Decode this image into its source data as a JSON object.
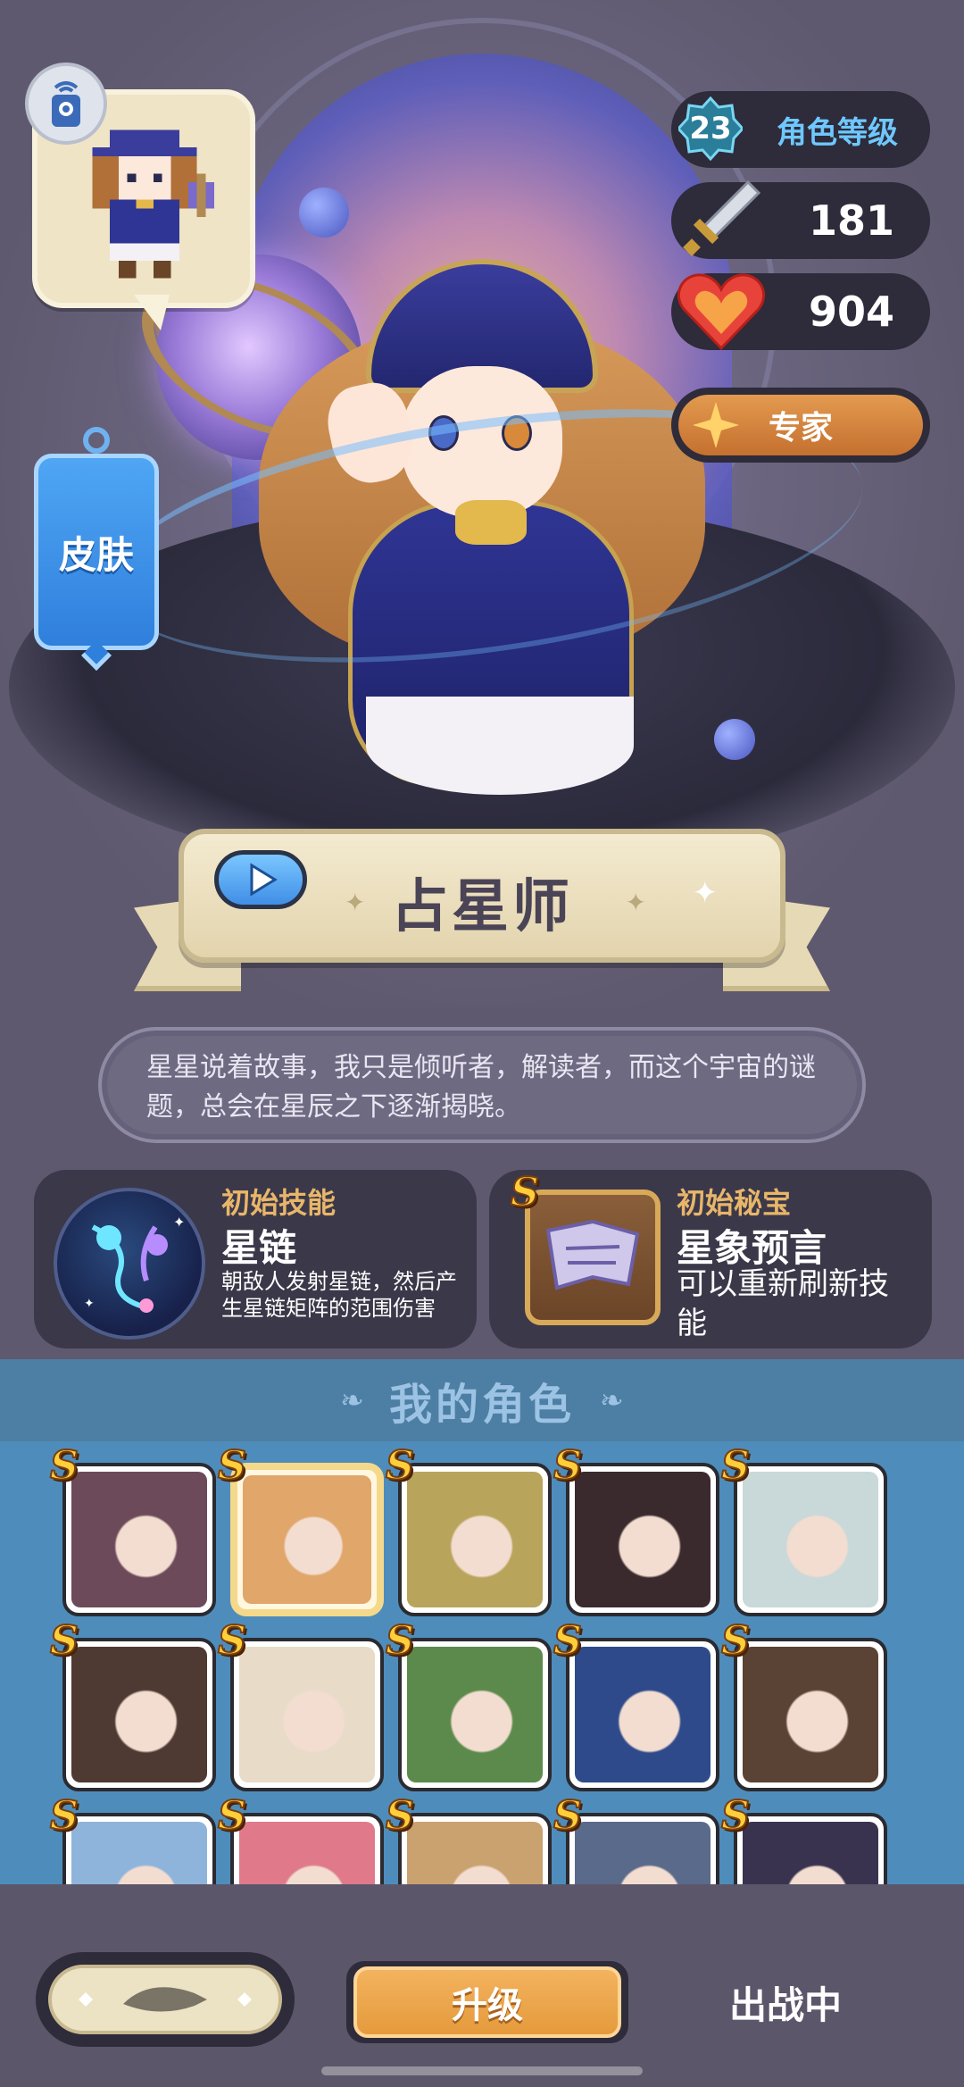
{
  "hero": {
    "name": "占星师",
    "quote": "星星说着故事，我只是倾听者，解读者，而这个宇宙的谜题，总会在星辰之下逐渐揭晓。"
  },
  "skin_button": {
    "label": "皮肤"
  },
  "stats": {
    "level": "23",
    "level_label": "角色等级",
    "attack": "181",
    "hp": "904",
    "rank_label": "专家"
  },
  "skill": {
    "title": "初始技能",
    "name": "星链",
    "desc": "朝敌人发射星链，然后产生星链矩阵的范围伤害"
  },
  "treasure": {
    "badge": "S",
    "title": "初始秘宝",
    "name": "星象预言",
    "desc": "可以重新刷新技能"
  },
  "roster": {
    "title": "我的角色",
    "tiles": [
      {
        "badge": "S",
        "color": "#6c4a5a"
      },
      {
        "badge": "S",
        "color": "#e0a66a",
        "selected": true
      },
      {
        "badge": "S",
        "color": "#b9a45c"
      },
      {
        "badge": "S",
        "color": "#3a2a2e"
      },
      {
        "badge": "S",
        "color": "#c9d8d8"
      },
      {
        "badge": "S",
        "color": "#4e3a32"
      },
      {
        "badge": "S",
        "color": "#e8dcc8"
      },
      {
        "badge": "S",
        "color": "#5c8a4c"
      },
      {
        "badge": "S",
        "color": "#2e4a8a"
      },
      {
        "badge": "S",
        "color": "#5a4234"
      },
      {
        "badge": "S",
        "color": "#8fb4dc"
      },
      {
        "badge": "S",
        "color": "#e07a8a"
      },
      {
        "badge": "S",
        "color": "#c9a270"
      },
      {
        "badge": "S",
        "color": "#5a6a8a"
      },
      {
        "badge": "S",
        "color": "#3a3350"
      }
    ]
  },
  "bottom": {
    "upgrade_label": "升级",
    "status_label": "出战中"
  },
  "colors": {
    "accent_orange": "#e39a4f",
    "skin_blue": "#3f8fe6",
    "level_text": "#6ec8ff",
    "gold_title": "#e8b66a"
  }
}
